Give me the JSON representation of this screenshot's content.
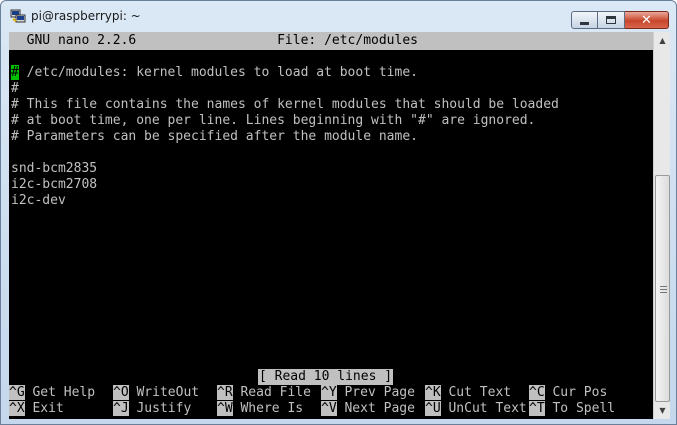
{
  "window": {
    "title": "pi@raspberrypi: ~",
    "icon": "putty-icon"
  },
  "nano": {
    "header": "  GNU nano 2.2.6                  File: /etc/modules",
    "cursor_char": "#",
    "lines": [
      " /etc/modules: kernel modules to load at boot time.",
      "#",
      "# This file contains the names of kernel modules that should be loaded",
      "# at boot time, one per line. Lines beginning with \"#\" are ignored.",
      "# Parameters can be specified after the module name.",
      "",
      "snd-bcm2835",
      "i2c-bcm2708",
      "i2c-dev"
    ],
    "status": "[ Read 10 lines ]",
    "shortcuts_row1": [
      {
        "key": "^G",
        "label": " Get Help  "
      },
      {
        "key": "^O",
        "label": " WriteOut  "
      },
      {
        "key": "^R",
        "label": " Read File "
      },
      {
        "key": "^Y",
        "label": " Prev Page "
      },
      {
        "key": "^K",
        "label": " Cut Text  "
      },
      {
        "key": "^C",
        "label": " Cur Pos"
      }
    ],
    "shortcuts_row2": [
      {
        "key": "^X",
        "label": " Exit      "
      },
      {
        "key": "^J",
        "label": " Justify   "
      },
      {
        "key": "^W",
        "label": " Where Is  "
      },
      {
        "key": "^V",
        "label": " Next Page "
      },
      {
        "key": "^U",
        "label": " UnCut Text"
      },
      {
        "key": "^T",
        "label": " To Spell"
      }
    ]
  },
  "colors": {
    "terminal_bg": "#000000",
    "terminal_fg": "#c0c0c0",
    "inverse_bg": "#c0c0c0",
    "cursor": "#00c000"
  }
}
